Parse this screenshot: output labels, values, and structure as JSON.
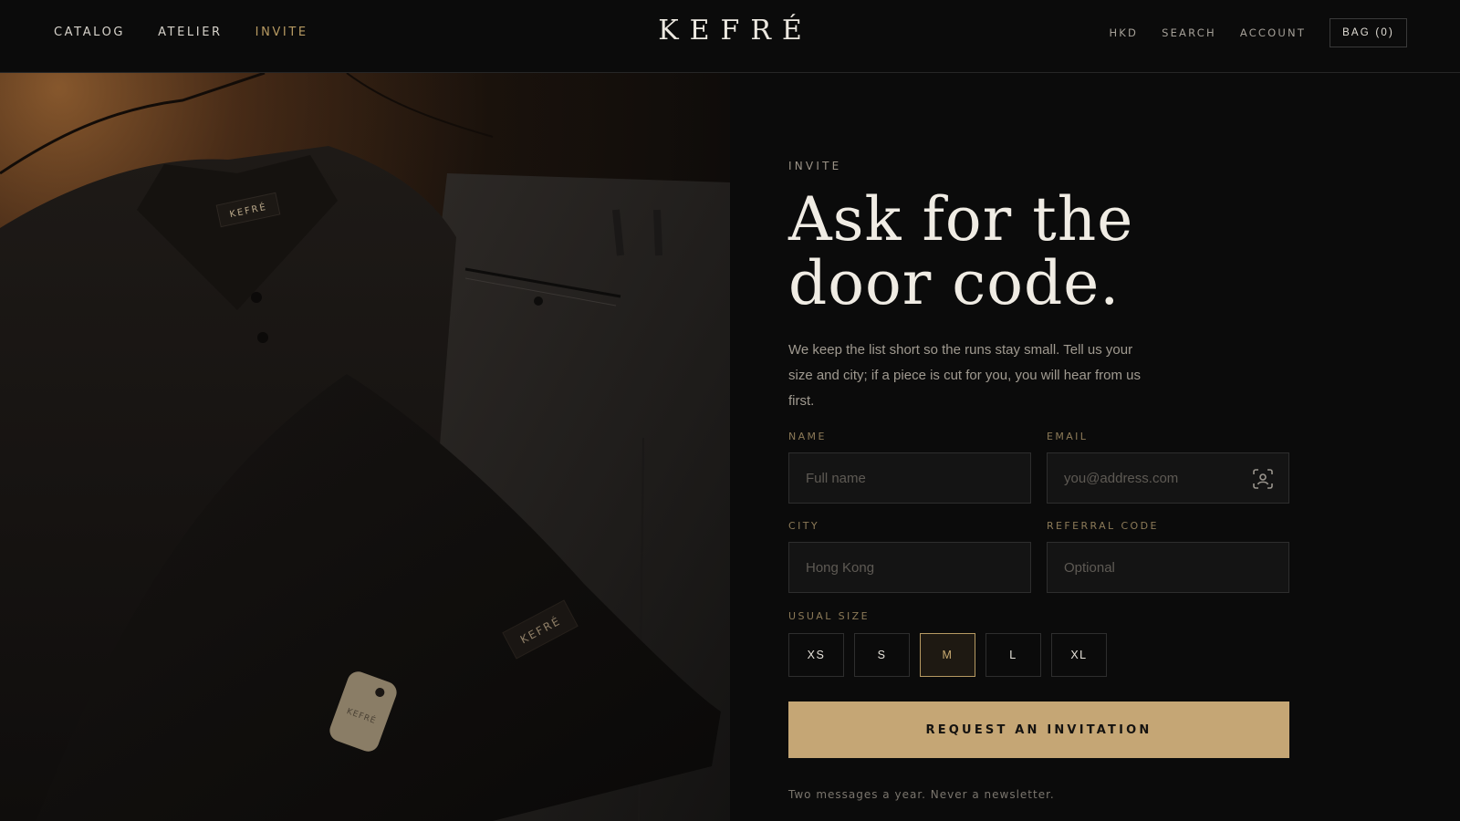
{
  "header": {
    "nav": [
      "CATALOG",
      "ATELIER",
      "INVITE"
    ],
    "active_nav": "INVITE",
    "logo": "KEFRÉ",
    "utilities": [
      "HKD",
      "SEARCH",
      "ACCOUNT"
    ],
    "bag_label": "BAG (0)"
  },
  "hero": {
    "garment_labels": [
      "KEFRÉ",
      "KEFRÉ",
      "KEFRÉ"
    ]
  },
  "form": {
    "eyebrow": "INVITE",
    "headline_line1": "Ask for the",
    "headline_line2": "door code.",
    "intro": "We keep the list short so the runs stay small. Tell us your size and city; if a piece is cut for you, you will hear from us first.",
    "name_label": "NAME",
    "name_placeholder": "Full name",
    "email_label": "EMAIL",
    "email_placeholder": "you@address.com",
    "email_icon": "contact-autofill-icon",
    "city_label": "CITY",
    "city_placeholder": "Hong Kong",
    "referral_label": "REFERRAL CODE",
    "referral_placeholder": "Optional",
    "size_label": "USUAL SIZE",
    "sizes": [
      "XS",
      "S",
      "M",
      "L",
      "XL"
    ],
    "selected_size": "M",
    "submit_label": "REQUEST AN INVITATION",
    "fineprint": "Two messages a year. Never a newsletter."
  },
  "colors": {
    "background": "#0b0b0b",
    "accent": "#c5a675",
    "accent_text": "#b79a62"
  }
}
